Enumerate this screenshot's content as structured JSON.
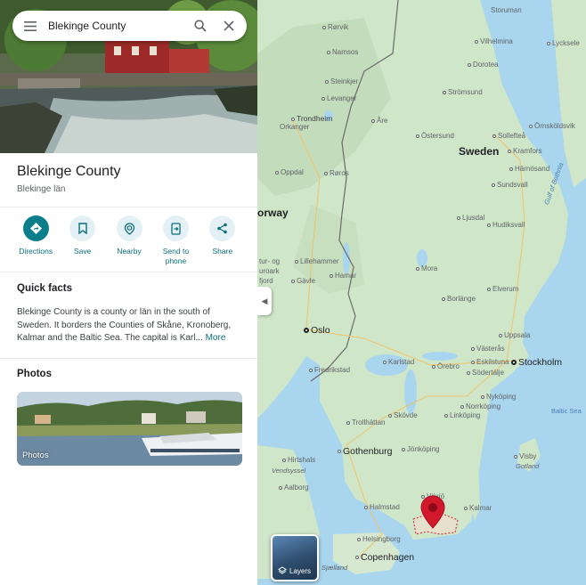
{
  "search": {
    "value": "Blekinge County"
  },
  "place": {
    "title": "Blekinge County",
    "subtitle": "Blekinge län"
  },
  "actions": [
    {
      "label": "Directions",
      "icon": "directions-icon"
    },
    {
      "label": "Save",
      "icon": "bookmark-icon"
    },
    {
      "label": "Nearby",
      "icon": "nearby-icon"
    },
    {
      "label": "Send to phone",
      "icon": "send-to-phone-icon"
    },
    {
      "label": "Share",
      "icon": "share-icon"
    }
  ],
  "quick_facts": {
    "heading": "Quick facts",
    "text": "Blekinge County is a county or län in the south of Sweden. It borders the Counties of Skåne, Kronoberg, Kalmar and the Baltic Sea. The capital is Karl...",
    "more": "More"
  },
  "photos": {
    "heading": "Photos",
    "label": "Photos"
  },
  "map": {
    "layers_label": "Layers",
    "countries": [
      "Sweden",
      "orway"
    ],
    "capitals": [
      "Oslo",
      "Stockholm"
    ],
    "major_cities": [
      "Gothenburg",
      "Copenhagen"
    ],
    "water": [
      "Gulf of Bothnia",
      "Baltic Sea",
      "Vendsyssel",
      "Sjælland"
    ],
    "places": [
      "Storuman",
      "Rørvik",
      "Vilhelmina",
      "Lycksele",
      "Namsos",
      "Dorotea",
      "Steinkjer",
      "Strömsund",
      "Levanger",
      "Trondheim",
      "Åre",
      "Örnsköldsvik",
      "Orkanger",
      "Östersund",
      "Sollefteå",
      "Kramfors",
      "Härnösand",
      "Oppdal",
      "Røros",
      "Sundsvall",
      "Ljusdal",
      "Hudiksvall",
      "Lillehammer",
      "Mora",
      "Gävle",
      "Hamar",
      "Elverum",
      "Borlänge",
      "Uppsala",
      "Västerås",
      "Karlstad",
      "Örebro",
      "Eskilstuna",
      "Södertälje",
      "Fredrikstad",
      "Nyköping",
      "Norrköping",
      "Trollhättan",
      "Skövde",
      "Linköping",
      "Jönköping",
      "Hirtshals",
      "Visby",
      "Gotland",
      "Aalborg",
      "Växjö",
      "Kalmar",
      "Halmstad",
      "Helsingborg",
      "Dre",
      "tur- og",
      "uroark",
      "fjord"
    ],
    "pin_color": "#d3182c",
    "selected_region": "Blekinge County"
  },
  "colors": {
    "accent": "#0b7e8c",
    "sea": "#a9d6ee",
    "land": "#cfe6c9"
  }
}
